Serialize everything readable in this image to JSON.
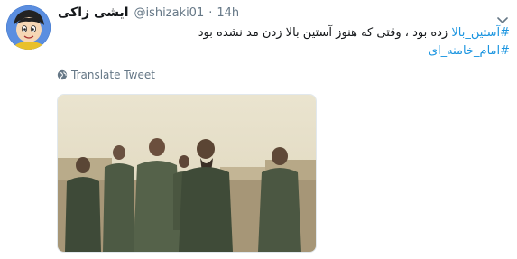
{
  "author": {
    "display_name": "ایشی زاکی",
    "handle": "@ishizaki01",
    "separator": "·",
    "time": "14h"
  },
  "tweet": {
    "hashtag_1": "#آستین_بالا",
    "text": " زده بود ، وقتی که هنوز آستین بالا زدن مد نشده بود",
    "hashtag_2": "#امام_خامنه_ای"
  },
  "translate_label": "Translate Tweet",
  "icons": {
    "avatar": "cartoon-avatar",
    "translate": "globe-icon",
    "menu": "chevron-down-icon"
  },
  "colors": {
    "link": "#1b95e0",
    "text": "#14171a",
    "meta": "#657786"
  }
}
